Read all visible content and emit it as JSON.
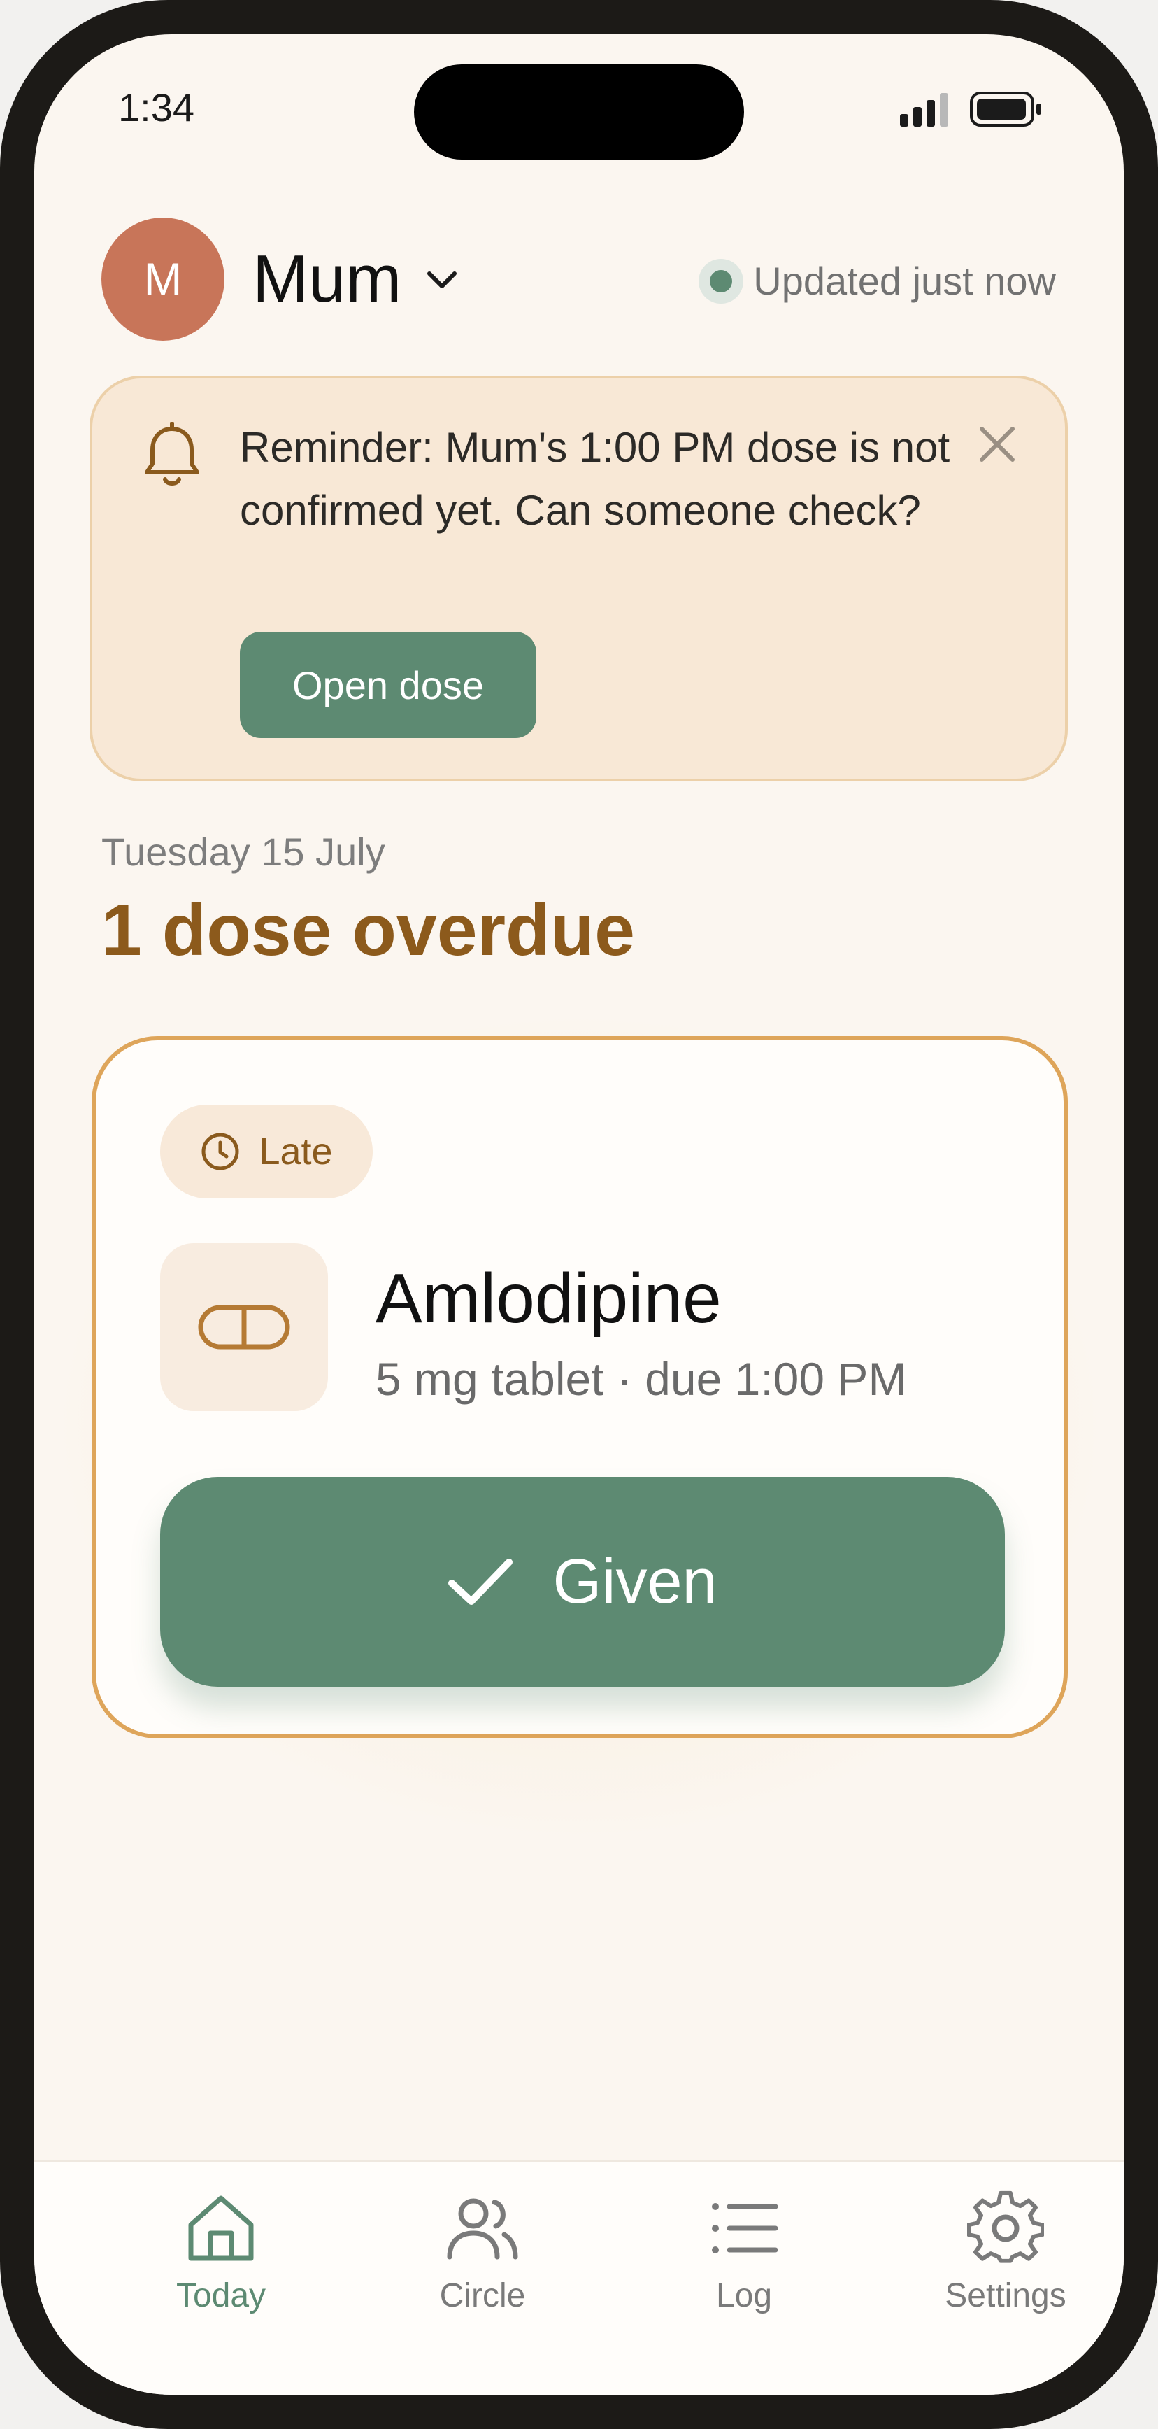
{
  "status_bar": {
    "time": "1:34"
  },
  "header": {
    "avatar_initial": "M",
    "person_name": "Mum",
    "updated_text": "Updated just now"
  },
  "reminder": {
    "text": "Reminder: Mum's 1:00 PM dose is not confirmed yet. Can someone check?",
    "button_label": "Open dose"
  },
  "today": {
    "date": "Tuesday 15 July",
    "summary": "1 dose overdue"
  },
  "dose": {
    "status_badge": "Late",
    "medication_name": "Amlodipine",
    "detail": "5 mg tablet · due 1:00 PM",
    "action_label": "Given"
  },
  "tabs": [
    {
      "label": "Today",
      "icon": "home-icon",
      "active": true
    },
    {
      "label": "Circle",
      "icon": "people-icon",
      "active": false
    },
    {
      "label": "Log",
      "icon": "list-icon",
      "active": false
    },
    {
      "label": "Settings",
      "icon": "gear-icon",
      "active": false
    }
  ],
  "colors": {
    "accent_green": "#5d8a72",
    "warning_brown": "#8c5a1c",
    "avatar": "#c87559",
    "card_border": "#dea55a"
  }
}
